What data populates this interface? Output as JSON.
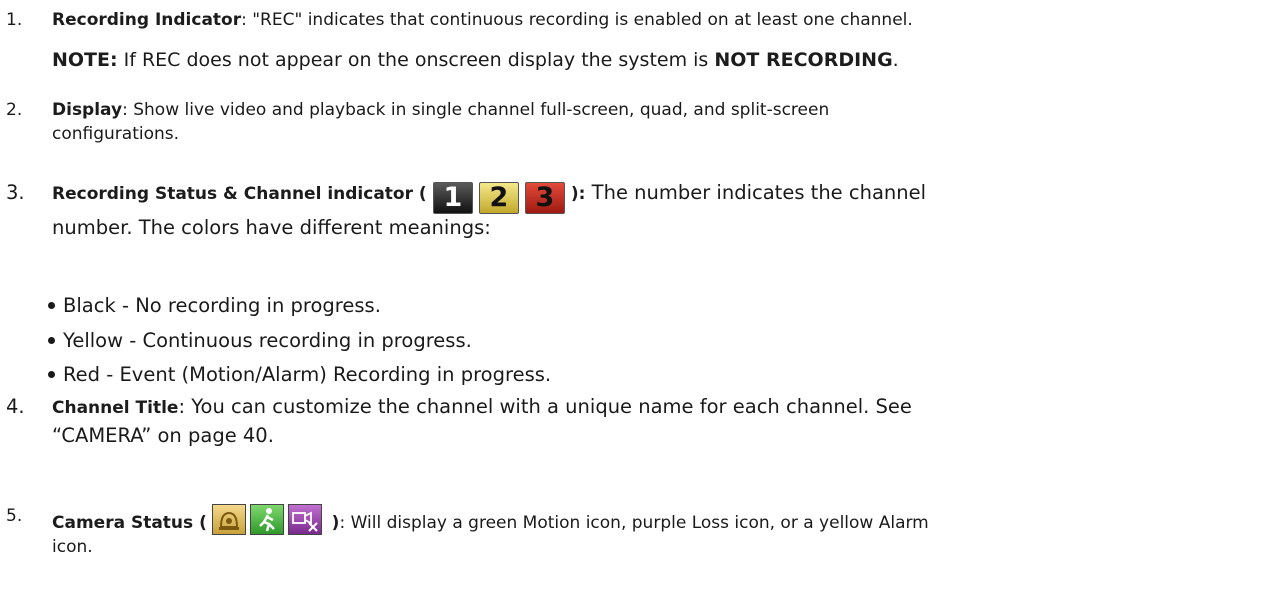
{
  "items": [
    {
      "number": "1.",
      "title": "Recording Indicator",
      "text": ": \"REC\" indicates that continuous recording is enabled on at least one channel.",
      "note": {
        "label": "NOTE:",
        "text_before": " If REC does not appear on the onscreen display the system is ",
        "emphasis": "NOT RECORDING",
        "text_after": "."
      }
    },
    {
      "number": "2.",
      "title": "Display",
      "text_line1": ": Show live video and playback in single channel full-screen, quad, and split-screen",
      "text_line2": "configurations."
    },
    {
      "number": "3.",
      "title": "Recording Status & Channel indicator (",
      "title_close": "):",
      "badges": [
        {
          "label": "1",
          "color": "#1a1a1a",
          "icon": "channel-1-black-icon"
        },
        {
          "label": "2",
          "color": "#d9c24a",
          "icon": "channel-2-yellow-icon"
        },
        {
          "label": "3",
          "color": "#c8281e",
          "icon": "channel-3-red-icon"
        }
      ],
      "text_line1": " The number indicates the channel",
      "text_line2": "number. The colors have different meanings:",
      "bullets": [
        "Black - No recording in progress.",
        "Yellow - Continuous recording in progress.",
        "Red - Event (Motion/Alarm) Recording in progress."
      ]
    },
    {
      "number": "4.",
      "title": "Channel Title",
      "text_line1": ": You can customize the channel with a unique name for each channel. See",
      "text_line2": "“CAMERA” on page 40."
    },
    {
      "number": "5.",
      "title": "Camera Status (",
      "title_close": ")",
      "status_icons": [
        {
          "icon": "alarm-icon",
          "color": "#d9b24a"
        },
        {
          "icon": "motion-icon",
          "color": "#3fae3a"
        },
        {
          "icon": "video-loss-icon",
          "color": "#9a3aa8"
        }
      ],
      "text_line1": ": Will display a green Motion icon, purple Loss icon, or a yellow Alarm",
      "text_line2": "icon."
    }
  ]
}
